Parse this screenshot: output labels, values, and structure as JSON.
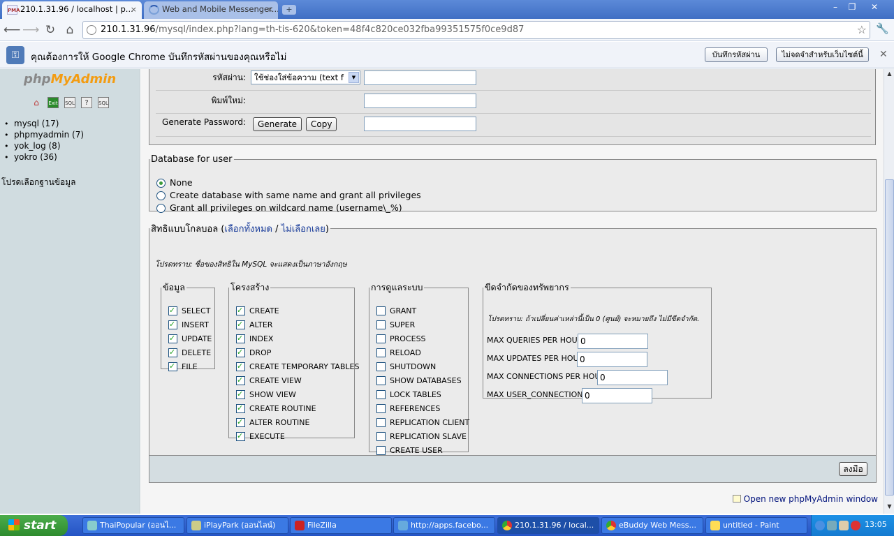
{
  "browser": {
    "tabs": [
      {
        "title": "210.1.31.96 / localhost | p...",
        "favicon": "PMA"
      },
      {
        "title": "Web and Mobile Messenger..."
      }
    ],
    "close_symbol": "×",
    "newtab_symbol": "+",
    "url_host": "210.1.31.96",
    "url_rest": "/mysql/index.php?lang=th-tis-620&token=48f4c820ce032fba99351575f0ce9d87",
    "window_buttons": [
      "–",
      "❐",
      "✕"
    ]
  },
  "infobar": {
    "message": "คุณต้องการให้ Google Chrome บันทึกรหัสผ่านของคุณหรือไม่",
    "save_button": "บันทึกรหัสผ่าน",
    "never_button": "ไม่จดจำสำหรับเว็บไซต์นี้",
    "close": "✕"
  },
  "sidebar": {
    "logo_php": "php",
    "logo_my": "MyAdmin",
    "icons": [
      "home-icon",
      "exit-icon",
      "sql-icon",
      "docs-icon",
      "query-window-icon"
    ],
    "icon_labels": [
      "⌂",
      "Exit",
      "SQL",
      "?",
      "SQL"
    ],
    "databases": [
      "mysql (17)",
      "phpmyadmin (7)",
      "yok_log (8)",
      "yokro (36)"
    ],
    "select_hint": "โปรดเลือกฐานข้อมูล"
  },
  "password_section": {
    "password_label": "รหัสผ่าน:",
    "password_select": "ใช้ช่องใส่ข้อความ (text f",
    "retype_label": "พิมพ์ใหม่:",
    "generate_label": "Generate Password:",
    "generate_button": "Generate",
    "copy_button": "Copy"
  },
  "database_for_user": {
    "legend": "Database for user",
    "options": [
      {
        "label": "None",
        "selected": true
      },
      {
        "label": "Create database with same name and grant all privileges",
        "selected": false
      },
      {
        "label": "Grant all privileges on wildcard name (username\\_%)",
        "selected": false
      }
    ]
  },
  "global_privileges": {
    "legend_prefix": "สิทธิแบบโกลบอล (",
    "check_all": "เลือกทั้งหมด",
    "separator": " / ",
    "uncheck_all": "ไม่เลือกเลย",
    "legend_suffix": ")",
    "note": "โปรดทราบ: ชื่อของสิทธิใน MySQL จะแสดงเป็นภาษาอังกฤษ",
    "groups": {
      "data": {
        "legend": "ข้อมูล",
        "items": [
          {
            "label": "SELECT",
            "checked": true
          },
          {
            "label": "INSERT",
            "checked": true
          },
          {
            "label": "UPDATE",
            "checked": true
          },
          {
            "label": "DELETE",
            "checked": true
          },
          {
            "label": "FILE",
            "checked": true
          }
        ]
      },
      "structure": {
        "legend": "โครงสร้าง",
        "items": [
          {
            "label": "CREATE",
            "checked": true
          },
          {
            "label": "ALTER",
            "checked": true
          },
          {
            "label": "INDEX",
            "checked": true
          },
          {
            "label": "DROP",
            "checked": true
          },
          {
            "label": "CREATE TEMPORARY TABLES",
            "checked": true
          },
          {
            "label": "CREATE VIEW",
            "checked": true
          },
          {
            "label": "SHOW VIEW",
            "checked": true
          },
          {
            "label": "CREATE ROUTINE",
            "checked": true
          },
          {
            "label": "ALTER ROUTINE",
            "checked": true
          },
          {
            "label": "EXECUTE",
            "checked": true
          }
        ]
      },
      "administration": {
        "legend": "การดูแลระบบ",
        "items": [
          {
            "label": "GRANT",
            "checked": false
          },
          {
            "label": "SUPER",
            "checked": false
          },
          {
            "label": "PROCESS",
            "checked": false
          },
          {
            "label": "RELOAD",
            "checked": false
          },
          {
            "label": "SHUTDOWN",
            "checked": false
          },
          {
            "label": "SHOW DATABASES",
            "checked": false
          },
          {
            "label": "LOCK TABLES",
            "checked": false
          },
          {
            "label": "REFERENCES",
            "checked": false
          },
          {
            "label": "REPLICATION CLIENT",
            "checked": false
          },
          {
            "label": "REPLICATION SLAVE",
            "checked": false
          },
          {
            "label": "CREATE USER",
            "checked": false
          }
        ]
      },
      "limits": {
        "legend": "ขีดจำกัดของทรัพยากร",
        "note": "โปรดทราบ: ถ้าเปลี่ยนค่าเหล่านี้เป็น 0 (ศูนย์) จะหมายถึง ไม่มีขีดจำกัด.",
        "items": [
          {
            "label": "MAX QUERIES PER HOUR",
            "value": "0"
          },
          {
            "label": "MAX UPDATES PER HOUR",
            "value": "0"
          },
          {
            "label": "MAX CONNECTIONS PER HOUR",
            "value": "0"
          },
          {
            "label": "MAX USER_CONNECTIONS",
            "value": "0"
          }
        ]
      }
    }
  },
  "submit_button": "ลงมือ",
  "open_new_window": "Open new phpMyAdmin window",
  "taskbar": {
    "start": "start",
    "tasks": [
      "ThaiPopular (ออนไ...",
      "iPlayPark (ออนไลน์)",
      "FileZilla",
      "http://apps.facebo...",
      "210.1.31.96 / local...",
      "eBuddy Web Mess...",
      "untitled - Paint"
    ],
    "clock": "13:05"
  }
}
